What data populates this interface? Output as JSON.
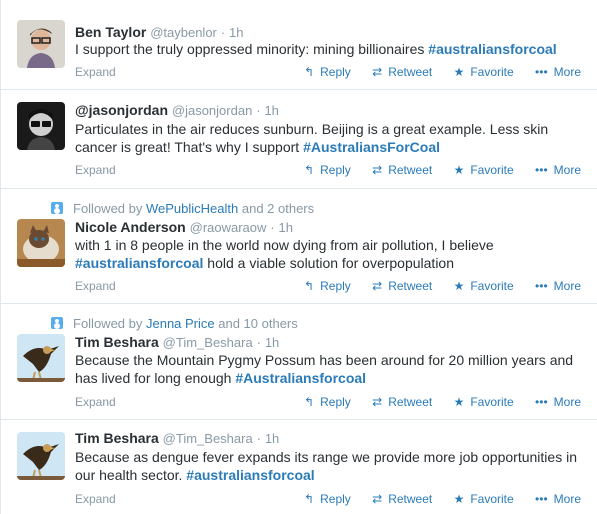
{
  "tweets": [
    {
      "context_prefix": "",
      "context_link": "",
      "context_suffix": "",
      "fullname": "Ben Taylor",
      "username": "@taybenlor",
      "time": "1h",
      "text": "I support the truly oppressed minority: mining billionaires ",
      "tag": "#australiansforcoal",
      "text_after": "",
      "expand": "Expand"
    },
    {
      "context_prefix": "",
      "context_link": "",
      "context_suffix": "",
      "fullname": "@jasonjordan",
      "username": "@jasonjordan",
      "time": "1h",
      "text": "Particulates in the air reduces sunburn.  Beijing is a great example.  Less skin cancer is great! That's why I support ",
      "tag": "#AustraliansForCoal",
      "text_after": "",
      "expand": "Expand"
    },
    {
      "context_prefix": "Followed by ",
      "context_link": "WePublicHealth",
      "context_suffix": " and 2 others",
      "fullname": "Nicole Anderson",
      "username": "@raowaraow",
      "time": "1h",
      "text": "with 1 in 8 people in the world now dying from air pollution, I believe ",
      "tag": "#australiansforcoal",
      "text_after": " hold a viable solution for overpopulation",
      "expand": "Expand"
    },
    {
      "context_prefix": "Followed by ",
      "context_link": "Jenna Price",
      "context_suffix": " and 10 others",
      "fullname": "Tim Beshara",
      "username": "@Tim_Beshara",
      "time": "1h",
      "text": "Because the Mountain Pygmy Possum has been around for 20 million years and has lived for long enough ",
      "tag": "#Australiansforcoal",
      "text_after": "",
      "expand": "Expand"
    },
    {
      "context_prefix": "",
      "context_link": "",
      "context_suffix": "",
      "fullname": "Tim Beshara",
      "username": "@Tim_Beshara",
      "time": "1h",
      "text": "Because as dengue fever expands its range we provide more job opportunities in our health sector. ",
      "tag": "#australiansforcoal",
      "text_after": "",
      "expand": "Expand"
    }
  ],
  "actions": {
    "reply": "Reply",
    "retweet": "Retweet",
    "favorite": "Favorite",
    "more": "More"
  },
  "separator": "·",
  "colors": {
    "link": "#2b7bb9",
    "muted": "#8899a6",
    "border": "#e1e8ed"
  }
}
